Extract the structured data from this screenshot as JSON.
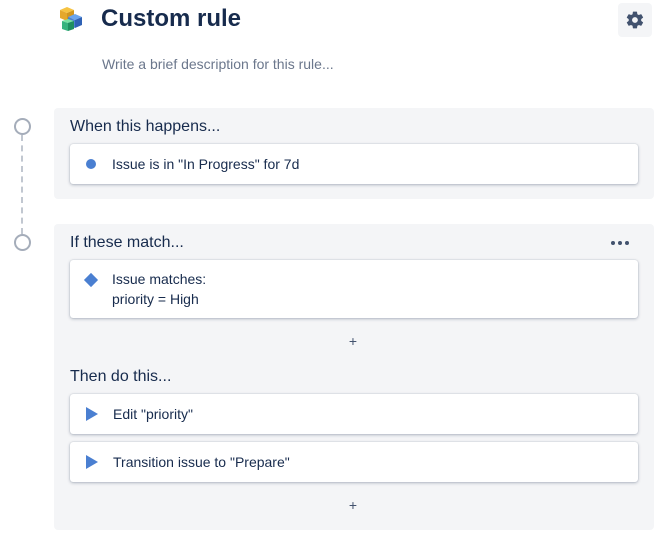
{
  "header": {
    "title": "Custom rule",
    "description_placeholder": "Write a brief description for this rule..."
  },
  "trigger": {
    "heading": "When this happens...",
    "card_text": "Issue is in \"In Progress\" for 7d"
  },
  "condition": {
    "heading": "If these match...",
    "card_line1": "Issue matches:",
    "card_line2": "priority = High",
    "add_label": "+"
  },
  "actions": {
    "heading": "Then do this...",
    "items": [
      {
        "label": "Edit \"priority\""
      },
      {
        "label": "Transition issue to \"Prepare\""
      }
    ],
    "add_label": "+"
  },
  "icons": {
    "logo": "automation-cube-logo",
    "settings": "gear-icon",
    "more": "more-horizontal-icon",
    "trigger": "dot-icon",
    "condition": "diamond-icon",
    "action": "play-icon"
  },
  "colors": {
    "accent": "#4a7fd1",
    "panel": "#f4f5f7",
    "text": "#172b4d",
    "muted": "#6b778c"
  }
}
